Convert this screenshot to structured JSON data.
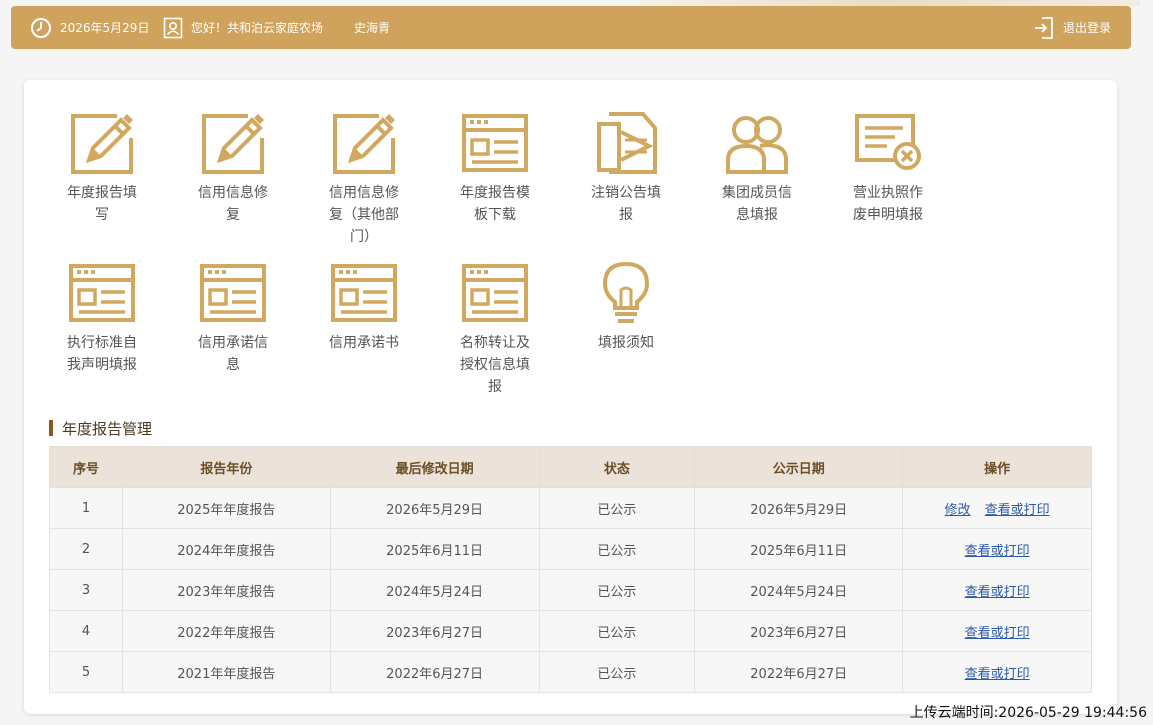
{
  "header": {
    "date": "2026年5月29日",
    "greeting": "您好！共和泊云家庭农场",
    "user": "史海青",
    "logout": "退出登录"
  },
  "tiles": [
    {
      "label": "年度报告填写",
      "icon": "edit-pen-icon"
    },
    {
      "label": "信用信息修复",
      "icon": "edit-pen-icon"
    },
    {
      "label": "信用信息修复（其他部门）",
      "icon": "edit-pen-icon"
    },
    {
      "label": "年度报告模板下载",
      "icon": "form-window-icon"
    },
    {
      "label": "注销公告填报",
      "icon": "document-fold-icon"
    },
    {
      "label": "集团成员信息填报",
      "icon": "group-users-icon"
    },
    {
      "label": "营业执照作废申明填报",
      "icon": "license-cancel-icon"
    },
    {
      "label": "执行标准自我声明填报",
      "icon": "form-window-icon"
    },
    {
      "label": "信用承诺信息",
      "icon": "form-window-icon"
    },
    {
      "label": "信用承诺书",
      "icon": "form-window-icon"
    },
    {
      "label": "名称转让及授权信息填报",
      "icon": "form-window-icon"
    },
    {
      "label": "填报须知",
      "icon": "lightbulb-icon"
    }
  ],
  "section": {
    "title": "年度报告管理"
  },
  "table": {
    "headers": [
      "序号",
      "报告年份",
      "最后修改日期",
      "状态",
      "公示日期",
      "操作"
    ],
    "rows": [
      {
        "no": "1",
        "year": "2025年年度报告",
        "modified": "2026年5月29日",
        "status": "已公示",
        "published": "2026年5月29日",
        "actions": [
          "修改",
          "查看或打印"
        ]
      },
      {
        "no": "2",
        "year": "2024年年度报告",
        "modified": "2025年6月11日",
        "status": "已公示",
        "published": "2025年6月11日",
        "actions": [
          "查看或打印"
        ]
      },
      {
        "no": "3",
        "year": "2023年年度报告",
        "modified": "2024年5月24日",
        "status": "已公示",
        "published": "2024年5月24日",
        "actions": [
          "查看或打印"
        ]
      },
      {
        "no": "4",
        "year": "2022年年度报告",
        "modified": "2023年6月27日",
        "status": "已公示",
        "published": "2023年6月27日",
        "actions": [
          "查看或打印"
        ]
      },
      {
        "no": "5",
        "year": "2021年年度报告",
        "modified": "2022年6月27日",
        "status": "已公示",
        "published": "2022年6月27日",
        "actions": [
          "查看或打印"
        ]
      }
    ]
  },
  "footer": {
    "upload_time": "上传云端时间:2026-05-29 19:44:56"
  },
  "colors": {
    "accent": "#cfa35c",
    "icon": "#d1a85f",
    "link": "#2b5aa8"
  }
}
